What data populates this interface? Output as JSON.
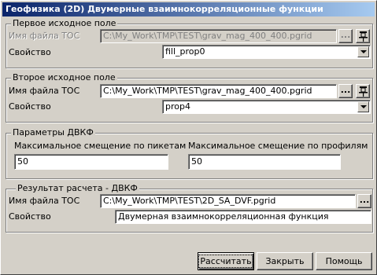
{
  "window": {
    "title": "Геофизика (2D) Двумерные взаимнокорреляционные функции",
    "close_glyph": "✕"
  },
  "source1": {
    "title": "Первое исходное поле",
    "file_label": "Имя файла ТОС",
    "file_value": "C:\\My_Work\\TMP\\TEST\\grav_mag_400_400.pgrid",
    "browse_label": "...",
    "property_label": "Свойство",
    "property_value": "fill_prop0"
  },
  "source2": {
    "title": "Второе исходное поле",
    "file_label": "Имя файла ТОС",
    "file_value": "C:\\My_Work\\TMP\\TEST\\grav_mag_400_400.pgrid",
    "browse_label": "...",
    "property_label": "Свойство",
    "property_value": "prop4"
  },
  "params": {
    "title": "Параметры ДВКФ",
    "offset_pickets_label": "Максимальное смещение по пикетам",
    "offset_pickets_value": "50",
    "offset_profiles_label": "Максимальное смещение по профилям",
    "offset_profiles_value": "50"
  },
  "result": {
    "title": "Результат расчета - ДВКФ",
    "file_label": "Имя файла ТОС",
    "file_value": "C:\\My_Work\\TMP\\TEST\\2D_SA_DVF.pgrid",
    "browse_label": "...",
    "property_label": "Свойство",
    "property_value": "Двумерная взаимнокорреляционная функция"
  },
  "buttons": {
    "calculate": "Рассчитать",
    "close": "Закрыть",
    "help": "Помощь"
  }
}
